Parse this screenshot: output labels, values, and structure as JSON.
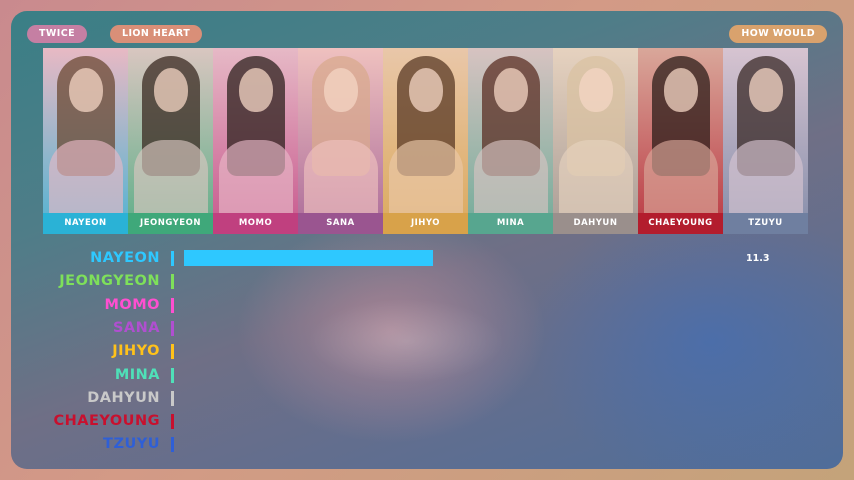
{
  "header": {
    "group_label": "TWICE",
    "song_label": "LION HEART",
    "next_label": "HOW WOULD"
  },
  "members": [
    {
      "name": "NAYEON",
      "color": "#2ab2d6",
      "hair": "#6b4a33",
      "body": "#e8b9c4"
    },
    {
      "name": "JEONGYEON",
      "color": "#3fa87a",
      "hair": "#3a2a22",
      "body": "#d9c6c0"
    },
    {
      "name": "MOMO",
      "color": "#c0407f",
      "hair": "#2d211d",
      "body": "#e6b9c6"
    },
    {
      "name": "SANA",
      "color": "#9a5590",
      "hair": "#d8aa8e",
      "body": "#efc1bf"
    },
    {
      "name": "JIHYO",
      "color": "#d8a24a",
      "hair": "#5a3a26",
      "body": "#e9c7a9"
    },
    {
      "name": "MINA",
      "color": "#57a68f",
      "hair": "#5b2f24",
      "body": "#d7c3c1"
    },
    {
      "name": "DAHYUN",
      "color": "#9a8f8c",
      "hair": "#d9c1a2",
      "body": "#e6d2bf"
    },
    {
      "name": "CHAEYOUNG",
      "color": "#b31d2d",
      "hair": "#2c1d1a",
      "body": "#d9a79a"
    },
    {
      "name": "TZUYU",
      "color": "#6f7fa0",
      "hair": "#3a2a27",
      "body": "#d7c4d1"
    }
  ],
  "chart_data": {
    "type": "bar",
    "categories": [
      "NAYEON",
      "JEONGYEON",
      "MOMO",
      "SANA",
      "JIHYO",
      "MINA",
      "DAHYUN",
      "CHAEYOUNG",
      "TZUYU"
    ],
    "values": [
      11.3,
      0,
      0,
      0,
      0,
      0,
      0,
      0,
      0
    ],
    "value_labels": [
      "11.3",
      "",
      "",
      "",
      "",
      "",
      "",
      "",
      ""
    ],
    "colors": [
      "#2ec8ff",
      "#7ee05a",
      "#ff4fd0",
      "#b04fd0",
      "#ffc21a",
      "#4fe0b8",
      "#c9c9c9",
      "#c8102e",
      "#2f5fd6"
    ],
    "xlim": [
      0,
      30
    ],
    "grid": false
  }
}
